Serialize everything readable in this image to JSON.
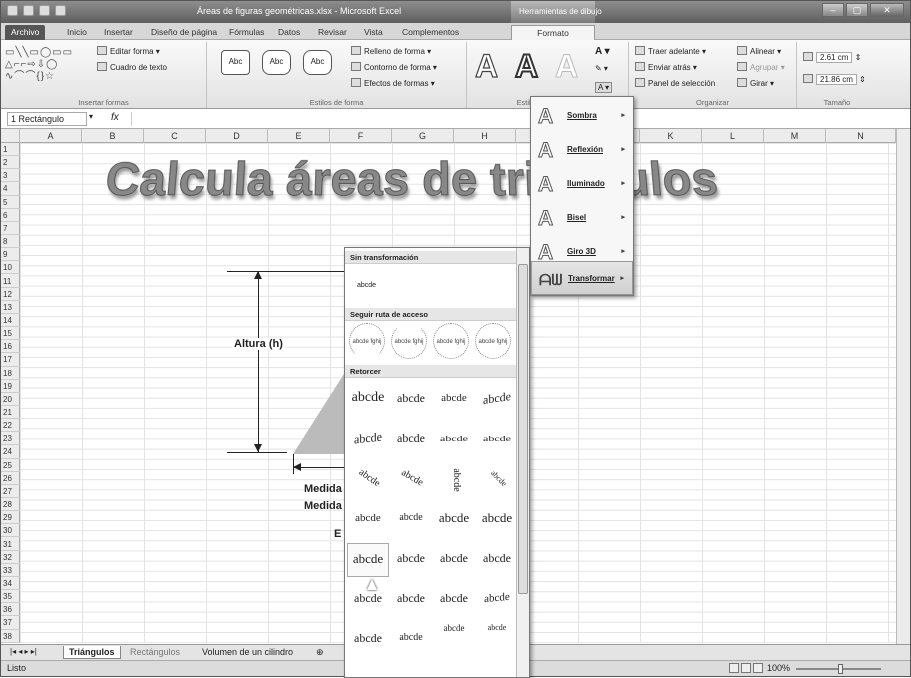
{
  "window": {
    "title": "Áreas de figuras geométricas.xlsx - Microsoft Excel",
    "context_tab": "Herramientas de dibujo",
    "controls": {
      "minimize": "–",
      "maximize": "▢",
      "close": "✕"
    }
  },
  "tabs": [
    "Archivo",
    "Inicio",
    "Insertar",
    "Diseño de página",
    "Fórmulas",
    "Datos",
    "Revisar",
    "Vista",
    "Complementos",
    "Formato"
  ],
  "ribbon": {
    "insert_shapes": {
      "edit_shape": "Editar forma",
      "text_box": "Cuadro de texto",
      "label": "Insertar formas"
    },
    "shape_styles": {
      "style_sample": "Abc",
      "fill": "Relleno de forma",
      "outline": "Contorno de forma",
      "effects": "Efectos de formas",
      "label": "Estilos de forma"
    },
    "wordart": {
      "glyph": "A",
      "label": "Estilos de WordArt"
    },
    "arrange": {
      "bring_forward": "Traer adelante",
      "send_backward": "Enviar atrás",
      "selection_pane": "Panel de selección",
      "align": "Alinear",
      "group": "Agrupar",
      "rotate": "Girar",
      "label": "Organizar"
    },
    "size": {
      "height": "2.61 cm",
      "width": "21.86 cm",
      "label": "Tamaño"
    }
  },
  "formula_bar": {
    "name_box": "1 Rectángulo",
    "fx": "fx"
  },
  "columns": [
    "A",
    "B",
    "C",
    "D",
    "E",
    "F",
    "G",
    "H",
    "I",
    "J",
    "K",
    "L",
    "M",
    "N"
  ],
  "rows": [
    "1",
    "2",
    "3",
    "4",
    "5",
    "6",
    "7",
    "8",
    "9",
    "10",
    "11",
    "12",
    "13",
    "14",
    "15",
    "16",
    "17",
    "18",
    "19",
    "20",
    "21",
    "22",
    "23",
    "24",
    "25",
    "26",
    "27",
    "28",
    "29",
    "30",
    "31",
    "32",
    "33",
    "34",
    "35",
    "36",
    "37",
    "38"
  ],
  "sheet": {
    "wordart_title": "Calcula áreas de triángulos",
    "height_label": "Altura (h)",
    "measure_1": "Medida",
    "measure_2": "Medida",
    "e_stub": "E"
  },
  "gallery": {
    "section_none": "Sin transformación",
    "plain_sample": "abcde",
    "section_path": "Seguir ruta de acceso",
    "path_sample": "abcde fghij",
    "section_warp": "Retorcer",
    "warp_sample": "abcde"
  },
  "effects_menu": [
    "Sombra",
    "Reflexión",
    "Iluminado",
    "Bisel",
    "Giro 3D",
    "Transformar"
  ],
  "sheet_tabs": [
    "Triángulos",
    "Rectángulos",
    "Volumen de un cilindro"
  ],
  "status": {
    "ready": "Listo",
    "zoom": "100%"
  }
}
